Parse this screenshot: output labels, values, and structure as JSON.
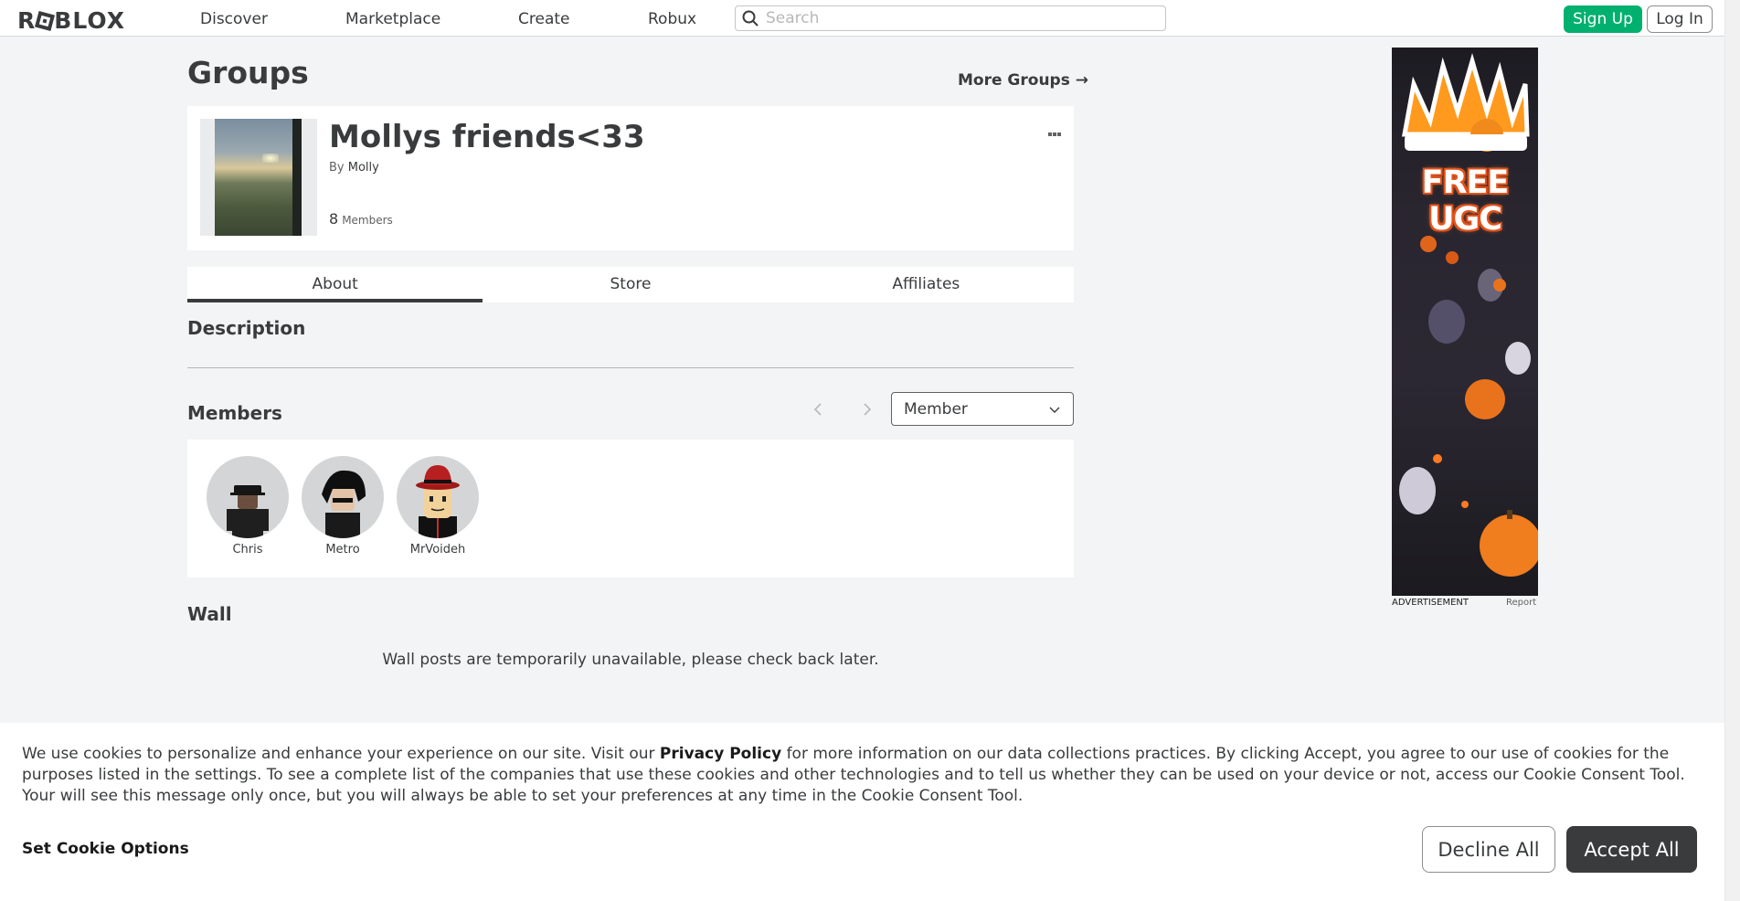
{
  "header": {
    "logo_text": "ROBLOX",
    "nav": [
      "Discover",
      "Marketplace",
      "Create",
      "Robux"
    ],
    "search_placeholder": "Search",
    "signup_label": "Sign Up",
    "login_label": "Log In"
  },
  "page": {
    "title": "Groups",
    "more_groups": "More Groups →"
  },
  "group": {
    "name": "Mollys friends<33",
    "by_prefix": "By",
    "owner": "Molly",
    "member_count": "8",
    "member_count_label": "Members"
  },
  "tabs": [
    "About",
    "Store",
    "Affiliates"
  ],
  "about": {
    "description_title": "Description",
    "members_title": "Members",
    "role_selected": "Member",
    "members": [
      {
        "name": "Chris"
      },
      {
        "name": "Metro"
      },
      {
        "name": "MrVoideh"
      }
    ],
    "wall_title": "Wall",
    "wall_message": "Wall posts are temporarily unavailable, please check back later."
  },
  "ad": {
    "headline": "FREE UGC",
    "label": "ADVERTISEMENT",
    "report": "Report"
  },
  "cookie": {
    "text_before": "We use cookies to personalize and enhance your experience on our site. Visit our ",
    "privacy_link": "Privacy Policy",
    "text_after": " for more information on our data collections practices. By clicking Accept, you agree to our use of cookies for the purposes listed in the settings. To see a complete list of the companies that use these cookies and other technologies and to tell us whether they can be used on your device or not, access our Cookie Consent Tool. Your will see this message only once, but you will always be able to set your preferences at any time in the Cookie Consent Tool.",
    "options_label": "Set Cookie Options",
    "decline_label": "Decline All",
    "accept_label": "Accept All"
  },
  "colors": {
    "signup_green": "#00b06f",
    "text_dark": "#393b3d",
    "page_bg": "#f2f4f5"
  }
}
